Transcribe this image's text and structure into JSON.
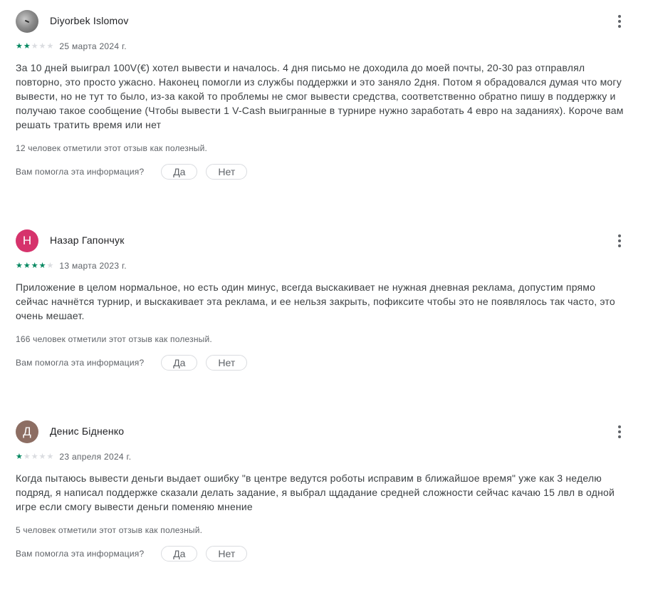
{
  "feedback_question": "Вам помогла эта информация?",
  "yes_label": "Да",
  "no_label": "Нет",
  "colors": {
    "star_filled": "#01875f",
    "star_empty": "#dadce0",
    "avatar_nazar": "#d6336c",
    "avatar_denys": "#8d6e63"
  },
  "icons": {
    "more": "more-vert-icon",
    "star": "star-icon"
  },
  "reviews": [
    {
      "author": "Diyorbek Islomov",
      "avatar_type": "photo",
      "avatar_letter": "",
      "rating": 2,
      "date": "25 марта 2024 г.",
      "text": "За 10 дней выиграл 100V(€) хотел вывести и началось. 4 дня письмо не доходила до моей почты, 20-30 раз отправлял повторно, это просто ужасно. Наконец помогли из службы поддержки и это заняло 2дня. Потом я обрадовался думая что могу вывести, но не тут то было, из-за какой то проблемы не смог вывести средства, соответственно обратно пишу в поддержку и получаю такое сообщение (Чтобы вывести 1 V-Cash выигранные в турнире нужно заработать 4 евро на заданиях). Короче вам решать тратить время или нет",
      "helpful": "12 человек отметили этот отзыв как полезный."
    },
    {
      "author": "Назар Гапончук",
      "avatar_type": "letter",
      "avatar_letter": "Н",
      "rating": 4,
      "date": "13 марта 2023 г.",
      "text": "Приложение в целом нормальное, но есть один минус, всегда выскакивает не нужная дневная реклама, допустим прямо сейчас начнётся турнир, и выскакивает эта реклама, и ее нельзя закрыть, пофиксите чтобы это не появлялось так часто, это очень мешает.",
      "helpful": "166 человек отметили этот отзыв как полезный."
    },
    {
      "author": "Денис Бідненко",
      "avatar_type": "letter",
      "avatar_letter": "Д",
      "rating": 1,
      "date": "23 апреля 2024 г.",
      "text": "Когда пытаюсь вывести деньги выдает ошибку \"в центре ведутся роботы исправим в ближайшое время\" уже как 3 неделю подряд, я написал поддержке сказали делать задание, я выбрал щдадание средней сложности сейчас качаю 15 лвл в одной игре если смогу вывести деньги поменяю мнение",
      "helpful": "5 человек отметили этот отзыв как полезный."
    }
  ]
}
